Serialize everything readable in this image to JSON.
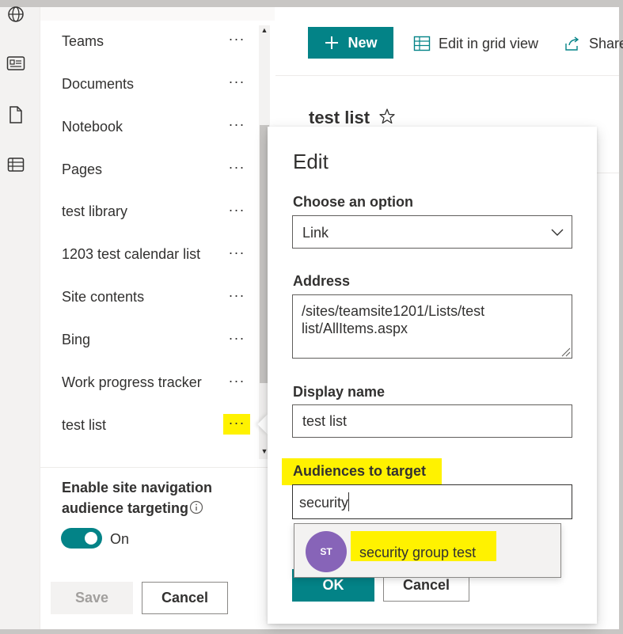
{
  "rail": {
    "icons": [
      "globe-icon",
      "news-icon",
      "document-icon",
      "list-icon"
    ]
  },
  "nav": {
    "items": [
      {
        "label": "Teams"
      },
      {
        "label": "Documents"
      },
      {
        "label": "Notebook"
      },
      {
        "label": "Pages"
      },
      {
        "label": "test library"
      },
      {
        "label": "1203 test calendar list"
      },
      {
        "label": "Site contents"
      },
      {
        "label": "Bing"
      },
      {
        "label": "Work progress tracker"
      },
      {
        "label": "test list"
      }
    ],
    "more_label": "···",
    "footer_title": "Enable site navigation audience targeting",
    "toggle_state": "On",
    "save_label": "Save",
    "cancel_label": "Cancel"
  },
  "command_bar": {
    "new_label": "New",
    "edit_grid_label": "Edit in grid view",
    "share_label": "Share"
  },
  "page": {
    "title": "test list"
  },
  "edit_callout": {
    "title": "Edit",
    "option_label": "Choose an option",
    "option_value": "Link",
    "address_label": "Address",
    "address_value": "/sites/teamsite1201/Lists/test list/AllItems.aspx",
    "display_name_label": "Display name",
    "display_name_value": "test list",
    "audiences_label": "Audiences to target",
    "audiences_input": "security",
    "suggestion": {
      "initials": "ST",
      "name": "security group test"
    },
    "ok_label": "OK",
    "cancel_label": "Cancel"
  },
  "colors": {
    "accent": "#038387",
    "highlight": "#fff200",
    "avatar": "#8764b8"
  }
}
